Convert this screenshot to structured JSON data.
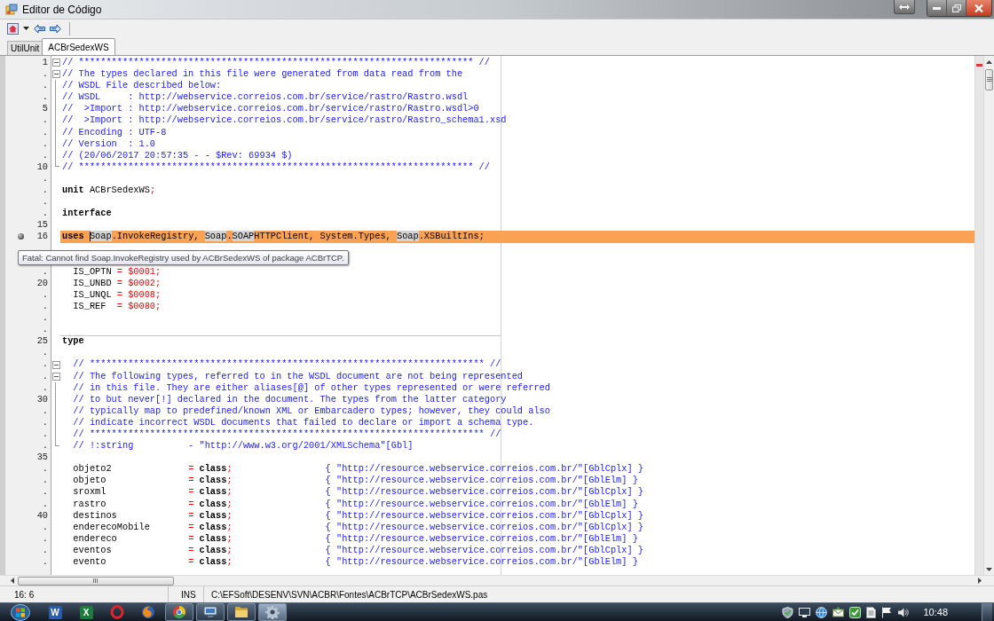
{
  "window": {
    "title": "Editor de Código"
  },
  "tabs": [
    {
      "label": "UtilUnit",
      "selected": false
    },
    {
      "label": "ACBrSedexWS",
      "selected": true
    }
  ],
  "editor": {
    "lines": [
      {
        "number": "1",
        "kind": "box",
        "error": false,
        "separator": false,
        "tokens": [
          {
            "kind": "comment",
            "text": "// ************************************************************************ //"
          }
        ]
      },
      {
        "number": ".",
        "kind": "box",
        "error": false,
        "separator": false,
        "tokens": [
          {
            "kind": "comment",
            "text": "// The types declared in this file were generated from data read from the"
          }
        ]
      },
      {
        "number": ".",
        "kind": "bar",
        "error": false,
        "separator": false,
        "tokens": [
          {
            "kind": "comment",
            "text": "// WSDL File described below:"
          }
        ]
      },
      {
        "number": ".",
        "kind": "bar",
        "error": false,
        "separator": false,
        "tokens": [
          {
            "kind": "comment",
            "text": "// WSDL     : http://webservice.correios.com.br/service/rastro/Rastro.wsdl"
          }
        ]
      },
      {
        "number": "5",
        "kind": "bar",
        "error": false,
        "separator": false,
        "tokens": [
          {
            "kind": "comment",
            "text": "//  >Import : http://webservice.correios.com.br/service/rastro/Rastro.wsdl>0"
          }
        ]
      },
      {
        "number": ".",
        "kind": "bar",
        "error": false,
        "separator": false,
        "tokens": [
          {
            "kind": "comment",
            "text": "//  >Import : http://webservice.correios.com.br/service/rastro/Rastro_schema1.xsd"
          }
        ]
      },
      {
        "number": ".",
        "kind": "bar",
        "error": false,
        "separator": false,
        "tokens": [
          {
            "kind": "comment",
            "text": "// Encoding : UTF-8"
          }
        ]
      },
      {
        "number": ".",
        "kind": "bar",
        "error": false,
        "separator": false,
        "tokens": [
          {
            "kind": "comment",
            "text": "// Version  : 1.0"
          }
        ]
      },
      {
        "number": ".",
        "kind": "bar",
        "error": false,
        "separator": false,
        "tokens": [
          {
            "kind": "comment",
            "text": "// (20/06/2017 20:57:35 - - $Rev: 69934 $)"
          }
        ]
      },
      {
        "number": "10",
        "kind": "end",
        "error": false,
        "separator": false,
        "tokens": [
          {
            "kind": "comment",
            "text": "// ************************************************************************ //"
          }
        ]
      },
      {
        "number": ".",
        "kind": "plain",
        "error": false,
        "separator": false
      },
      {
        "number": ".",
        "kind": "plain",
        "error": false,
        "separator": false,
        "tokens": [
          {
            "kind": "keyword",
            "text": "unit"
          },
          {
            "kind": "ident",
            "text": " ACBrSedexWS"
          },
          {
            "kind": "symbol",
            "text": ";"
          }
        ]
      },
      {
        "number": ".",
        "kind": "plain",
        "error": false,
        "separator": false
      },
      {
        "number": ".",
        "kind": "plain",
        "error": false,
        "separator": false,
        "tokens": [
          {
            "kind": "keyword",
            "text": "interface"
          }
        ]
      },
      {
        "number": "15",
        "kind": "plain",
        "error": false,
        "separator": false
      },
      {
        "number": "16",
        "kind": "plain",
        "error": true,
        "separator": false,
        "tokens": [
          {
            "kind": "keyword",
            "text": "uses "
          },
          {
            "kind": "caret"
          },
          {
            "kind": "match",
            "text": "Soap"
          },
          {
            "kind": "ident",
            "text": ".InvokeRegistry, "
          },
          {
            "kind": "match",
            "text": "Soap"
          },
          {
            "kind": "ident",
            "text": "."
          },
          {
            "kind": "match",
            "text": "SOAP"
          },
          {
            "kind": "ident",
            "text": "HTTPClient, System.Types, "
          },
          {
            "kind": "match",
            "text": "Soap"
          },
          {
            "kind": "ident",
            "text": ".XSBuiltIns;"
          }
        ]
      },
      {
        "kind": "plain",
        "error": false,
        "separator": false
      },
      {
        "kind": "plain",
        "error": false,
        "separator": false
      },
      {
        "number": ".",
        "kind": "plain",
        "error": false,
        "separator": false,
        "tokens": [
          {
            "kind": "ident",
            "text": "  IS_OPTN "
          },
          {
            "kind": "symbol",
            "text": "= $0001;"
          }
        ]
      },
      {
        "number": "20",
        "kind": "plain",
        "error": false,
        "separator": false,
        "tokens": [
          {
            "kind": "ident",
            "text": "  IS_UNBD "
          },
          {
            "kind": "symbol",
            "text": "= $0002;"
          }
        ]
      },
      {
        "number": ".",
        "kind": "plain",
        "error": false,
        "separator": false,
        "tokens": [
          {
            "kind": "ident",
            "text": "  IS_UNQL "
          },
          {
            "kind": "symbol",
            "text": "= $0008;"
          }
        ]
      },
      {
        "number": ".",
        "kind": "plain",
        "error": false,
        "separator": false,
        "tokens": [
          {
            "kind": "ident",
            "text": "  IS_REF  "
          },
          {
            "kind": "symbol",
            "text": "= $0080;"
          }
        ]
      },
      {
        "number": ".",
        "kind": "plain",
        "error": false,
        "separator": false
      },
      {
        "number": ".",
        "kind": "plain",
        "error": false,
        "separator": false
      },
      {
        "number": "25",
        "kind": "plain",
        "error": false,
        "separator": true,
        "tokens": [
          {
            "kind": "keyword",
            "text": "type"
          }
        ]
      },
      {
        "number": ".",
        "kind": "plain",
        "error": false,
        "separator": false
      },
      {
        "number": ".",
        "kind": "box",
        "error": false,
        "separator": false,
        "tokens": [
          {
            "kind": "comment",
            "text": "  // ************************************************************************ //"
          }
        ]
      },
      {
        "number": ".",
        "kind": "box",
        "error": false,
        "separator": false,
        "tokens": [
          {
            "kind": "comment",
            "text": "  // The following types, referred to in the WSDL document are not being represented"
          }
        ]
      },
      {
        "number": ".",
        "kind": "bar",
        "error": false,
        "separator": false,
        "tokens": [
          {
            "kind": "comment",
            "text": "  // in this file. They are either aliases[@] of other types represented or were referred"
          }
        ]
      },
      {
        "number": "30",
        "kind": "bar",
        "error": false,
        "separator": false,
        "tokens": [
          {
            "kind": "comment",
            "text": "  // to but never[!] declared in the document. The types from the latter category"
          }
        ]
      },
      {
        "number": ".",
        "kind": "bar",
        "error": false,
        "separator": false,
        "tokens": [
          {
            "kind": "comment",
            "text": "  // typically map to predefined/known XML or Embarcadero types; however, they could also"
          }
        ]
      },
      {
        "number": ".",
        "kind": "bar",
        "error": false,
        "separator": false,
        "tokens": [
          {
            "kind": "comment",
            "text": "  // indicate incorrect WSDL documents that failed to declare or import a schema type."
          }
        ]
      },
      {
        "number": ".",
        "kind": "bar",
        "error": false,
        "separator": false,
        "tokens": [
          {
            "kind": "comment",
            "text": "  // ************************************************************************ //"
          }
        ]
      },
      {
        "number": ".",
        "kind": "end",
        "error": false,
        "separator": false,
        "tokens": [
          {
            "kind": "comment",
            "text": "  // !:string          - \"http://www.w3.org/2001/XMLSchema\"[Gbl]"
          }
        ]
      },
      {
        "number": "35",
        "kind": "plain",
        "error": false,
        "separator": false
      },
      {
        "number": ".",
        "kind": "plain",
        "error": false,
        "separator": false,
        "tokens": [
          {
            "kind": "ident",
            "text": "  objeto2              "
          },
          {
            "kind": "symbol",
            "text": "= "
          },
          {
            "kind": "keyword",
            "text": "class"
          },
          {
            "kind": "symbol",
            "text": ";"
          },
          {
            "kind": "comment",
            "text": "                 { \"http://resource.webservice.correios.com.br/\"[GblCplx] }"
          }
        ]
      },
      {
        "number": ".",
        "kind": "plain",
        "error": false,
        "separator": false,
        "tokens": [
          {
            "kind": "ident",
            "text": "  objeto               "
          },
          {
            "kind": "symbol",
            "text": "= "
          },
          {
            "kind": "keyword",
            "text": "class"
          },
          {
            "kind": "symbol",
            "text": ";"
          },
          {
            "kind": "comment",
            "text": "                 { \"http://resource.webservice.correios.com.br/\"[GblElm] }"
          }
        ]
      },
      {
        "number": ".",
        "kind": "plain",
        "error": false,
        "separator": false,
        "tokens": [
          {
            "kind": "ident",
            "text": "  sroxml               "
          },
          {
            "kind": "symbol",
            "text": "= "
          },
          {
            "kind": "keyword",
            "text": "class"
          },
          {
            "kind": "symbol",
            "text": ";"
          },
          {
            "kind": "comment",
            "text": "                 { \"http://resource.webservice.correios.com.br/\"[GblCplx] }"
          }
        ]
      },
      {
        "number": ".",
        "kind": "plain",
        "error": false,
        "separator": false,
        "tokens": [
          {
            "kind": "ident",
            "text": "  rastro               "
          },
          {
            "kind": "symbol",
            "text": "= "
          },
          {
            "kind": "keyword",
            "text": "class"
          },
          {
            "kind": "symbol",
            "text": ";"
          },
          {
            "kind": "comment",
            "text": "                 { \"http://resource.webservice.correios.com.br/\"[GblElm] }"
          }
        ]
      },
      {
        "number": "40",
        "kind": "plain",
        "error": false,
        "separator": false,
        "tokens": [
          {
            "kind": "ident",
            "text": "  destinos             "
          },
          {
            "kind": "symbol",
            "text": "= "
          },
          {
            "kind": "keyword",
            "text": "class"
          },
          {
            "kind": "symbol",
            "text": ";"
          },
          {
            "kind": "comment",
            "text": "                 { \"http://resource.webservice.correios.com.br/\"[GblCplx] }"
          }
        ]
      },
      {
        "number": ".",
        "kind": "plain",
        "error": false,
        "separator": false,
        "tokens": [
          {
            "kind": "ident",
            "text": "  enderecoMobile       "
          },
          {
            "kind": "symbol",
            "text": "= "
          },
          {
            "kind": "keyword",
            "text": "class"
          },
          {
            "kind": "symbol",
            "text": ";"
          },
          {
            "kind": "comment",
            "text": "                 { \"http://resource.webservice.correios.com.br/\"[GblCplx] }"
          }
        ]
      },
      {
        "number": ".",
        "kind": "plain",
        "error": false,
        "separator": false,
        "tokens": [
          {
            "kind": "ident",
            "text": "  endereco             "
          },
          {
            "kind": "symbol",
            "text": "= "
          },
          {
            "kind": "keyword",
            "text": "class"
          },
          {
            "kind": "symbol",
            "text": ";"
          },
          {
            "kind": "comment",
            "text": "                 { \"http://resource.webservice.correios.com.br/\"[GblElm] }"
          }
        ]
      },
      {
        "number": ".",
        "kind": "plain",
        "error": false,
        "separator": false,
        "tokens": [
          {
            "kind": "ident",
            "text": "  eventos              "
          },
          {
            "kind": "symbol",
            "text": "= "
          },
          {
            "kind": "keyword",
            "text": "class"
          },
          {
            "kind": "symbol",
            "text": ";"
          },
          {
            "kind": "comment",
            "text": "                 { \"http://resource.webservice.correios.com.br/\"[GblCplx] }"
          }
        ]
      },
      {
        "number": ".",
        "kind": "plain",
        "error": false,
        "separator": false,
        "tokens": [
          {
            "kind": "ident",
            "text": "  evento               "
          },
          {
            "kind": "symbol",
            "text": "= "
          },
          {
            "kind": "keyword",
            "text": "class"
          },
          {
            "kind": "symbol",
            "text": ";"
          },
          {
            "kind": "comment",
            "text": "                 { \"http://resource.webservice.correios.com.br/\"[GblElm] }"
          }
        ]
      }
    ],
    "tooltip": "Fatal: Cannot find Soap.InvokeRegistry used by ACBrSedexWS of package ACBrTCP."
  },
  "status_bar": {
    "position": "16: 6",
    "mode": "INS",
    "file_path": "C:\\EFSoft\\DESENV\\SVN\\ACBR\\Fontes\\ACBrTCP\\ACBrSedexWS.pas"
  },
  "taskbar": {
    "apps": [
      {
        "kind": "doc",
        "glyph": "W",
        "running": false,
        "selected": false
      },
      {
        "kind": "sheet",
        "glyph": "X",
        "running": false,
        "selected": false
      },
      {
        "kind": "ring",
        "running": false,
        "selected": false
      },
      {
        "kind": "fox",
        "running": false,
        "selected": false
      },
      {
        "kind": "browser",
        "running": true,
        "selected": false
      },
      {
        "kind": "remote",
        "running": true,
        "selected": false
      },
      {
        "kind": "folder",
        "running": true,
        "selected": false
      },
      {
        "kind": "gear",
        "running": true,
        "selected": true
      }
    ],
    "clock": "10:48"
  }
}
